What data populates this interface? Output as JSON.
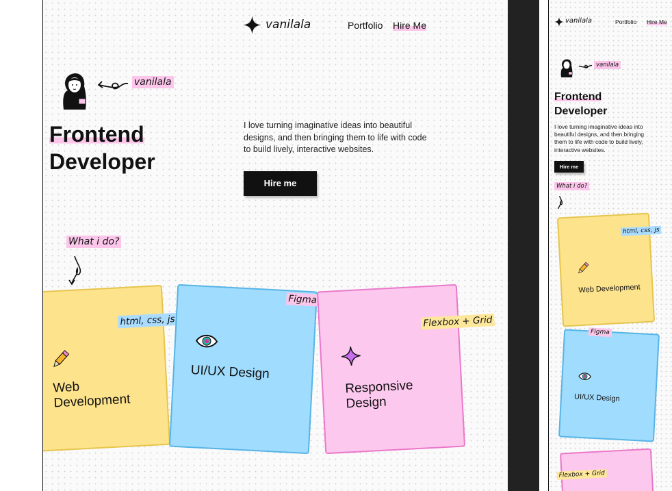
{
  "brand": {
    "name": "vanilala"
  },
  "nav": {
    "portfolio": "Portfolio",
    "hire": "Hire Me"
  },
  "hero": {
    "tag": "vanilala",
    "title_line1": "Frontend",
    "title_line2": "Developer",
    "description": "I love turning imaginative ideas into beautiful designs, and then bringing them to life with code to build lively, interactive websites.",
    "button": "Hire me"
  },
  "services": {
    "heading": "What i do?",
    "cards": [
      {
        "title_line1": "Web",
        "title_line2": "Development",
        "title": "Web Development",
        "tag": "html, css, js",
        "color": "#fde38c",
        "icon": "pencil-icon"
      },
      {
        "title": "UI/UX Design",
        "tag": "Figma",
        "color": "#9fdcfd",
        "icon": "eye-icon"
      },
      {
        "title_line1": "Responsive",
        "title_line2": "Design",
        "tag": "Flexbox + Grid",
        "color": "#fdc8ee",
        "icon": "sparkle-icon"
      }
    ]
  },
  "colors": {
    "accent_pink": "#fbc6ea",
    "accent_blue": "#a9dcff",
    "accent_yellow": "#fde79a",
    "button": "#111111"
  }
}
